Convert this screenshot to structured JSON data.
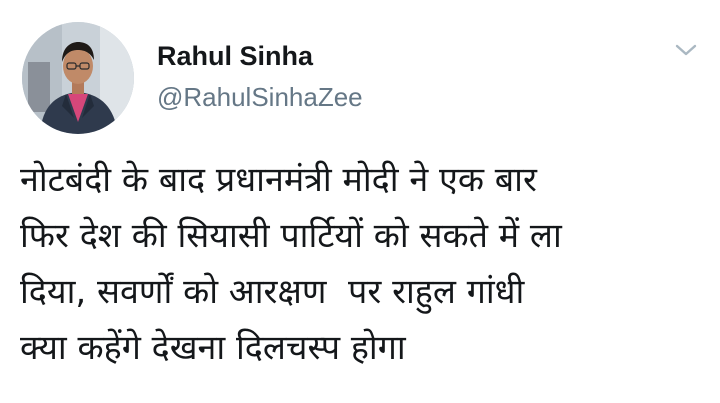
{
  "tweet": {
    "author": {
      "display_name": "Rahul Sinha",
      "handle": "@RahulSinhaZee"
    },
    "menu_icon": "chevron-down-icon",
    "text_lines": [
      "नोटबंदी के बाद प्रधानमंत्री मोदी ने एक बार",
      "फिर देश की सियासी पार्टियों को सकते में ला",
      "दिया, सवर्णों को आरक्षण  पर राहुल गांधी",
      "क्या कहेंगे देखना दिलचस्प होगा"
    ]
  },
  "colors": {
    "background": "#ffffff",
    "text_primary": "#14171a",
    "text_secondary": "#657786",
    "chevron": "#aab8c2"
  }
}
